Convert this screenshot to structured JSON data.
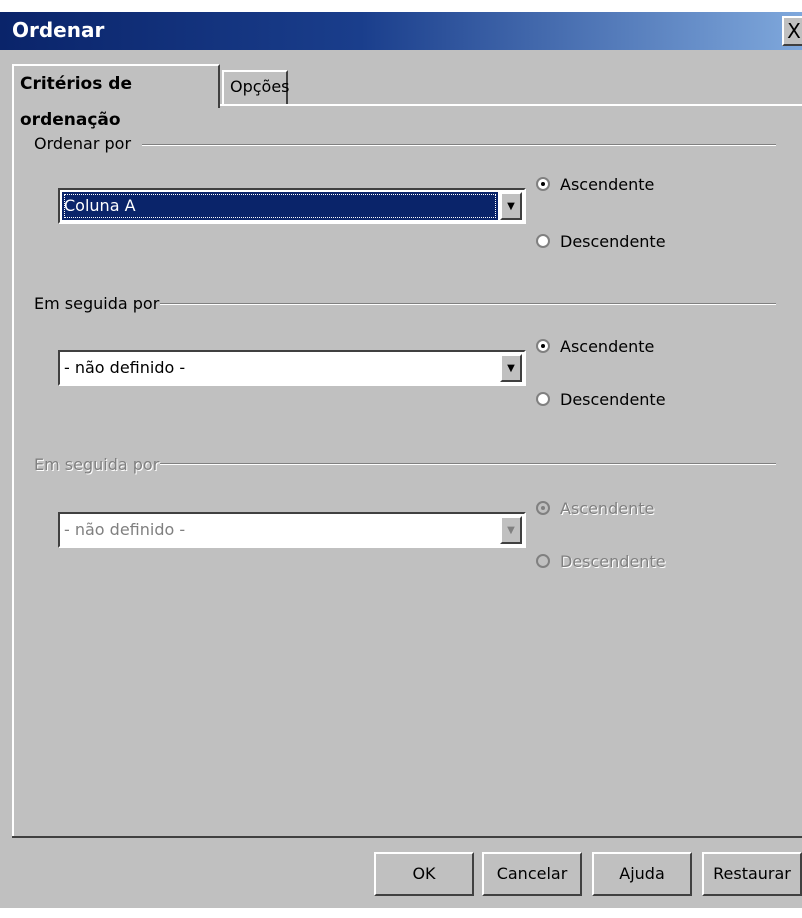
{
  "window": {
    "title": "Ordenar",
    "close_glyph": "X"
  },
  "tabs": [
    {
      "label": "Critérios de ordenação",
      "active": true
    },
    {
      "label": "Opções",
      "active": false
    }
  ],
  "groups": [
    {
      "label": "Ordenar por",
      "enabled": true,
      "combo_value": "Coluna A",
      "radio_ascending": "Ascendente",
      "radio_descending": "Descendente",
      "selected": "ascending"
    },
    {
      "label": "Em seguida por",
      "enabled": true,
      "combo_value": "- não definido -",
      "radio_ascending": "Ascendente",
      "radio_descending": "Descendente",
      "selected": "ascending"
    },
    {
      "label": "Em seguida por",
      "enabled": false,
      "combo_value": "- não definido -",
      "radio_ascending": "Ascendente",
      "radio_descending": "Descendente",
      "selected": "ascending"
    }
  ],
  "buttons": {
    "ok": "OK",
    "cancel": "Cancelar",
    "help": "Ajuda",
    "reset": "Restaurar"
  },
  "icons": {
    "dropdown": "chevron-down-icon",
    "close": "close-icon"
  },
  "colors": {
    "titlebar_start": "#0a246a",
    "titlebar_end": "#7fa8dc",
    "face": "#c0c0c0",
    "selection": "#0a246a"
  }
}
